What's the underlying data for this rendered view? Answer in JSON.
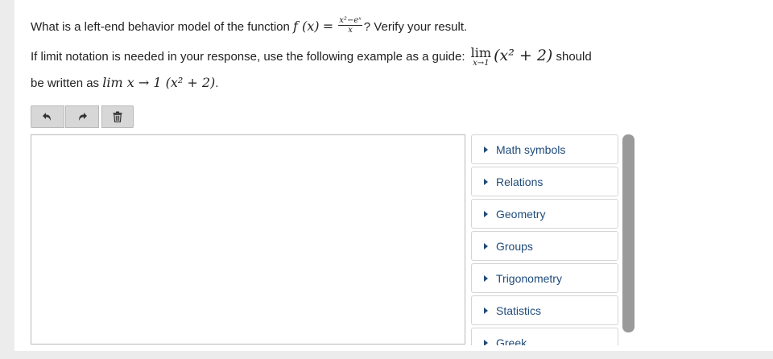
{
  "question": {
    "line1_before": "What is a left-end behavior model of the function",
    "func_lhs": "f (x)",
    "eq": "=",
    "frac_num": "x²−eˣ",
    "frac_den": "x",
    "line1_after": "? Verify your result.",
    "line2_before": "If limit notation is needed in your response, use the following example as a guide:",
    "lim_word": "lim",
    "lim_sub": "x→1",
    "lim_expr": "(x² + 2)",
    "line2_after": "should",
    "line3_before": "be written as",
    "line3_math": "lim x → 1 (x² + 2)",
    "line3_end": "."
  },
  "toolbar": {
    "undo_icon": "undo-icon",
    "redo_icon": "redo-icon",
    "delete_icon": "trash-icon"
  },
  "palette": {
    "items": [
      {
        "label": "Math symbols"
      },
      {
        "label": "Relations"
      },
      {
        "label": "Geometry"
      },
      {
        "label": "Groups"
      },
      {
        "label": "Trigonometry"
      },
      {
        "label": "Statistics"
      },
      {
        "label": "Greek"
      }
    ]
  },
  "colors": {
    "link": "#1f4b7a",
    "scrollbar": "#9a9a9a",
    "button_bg": "#d7d7d7"
  }
}
